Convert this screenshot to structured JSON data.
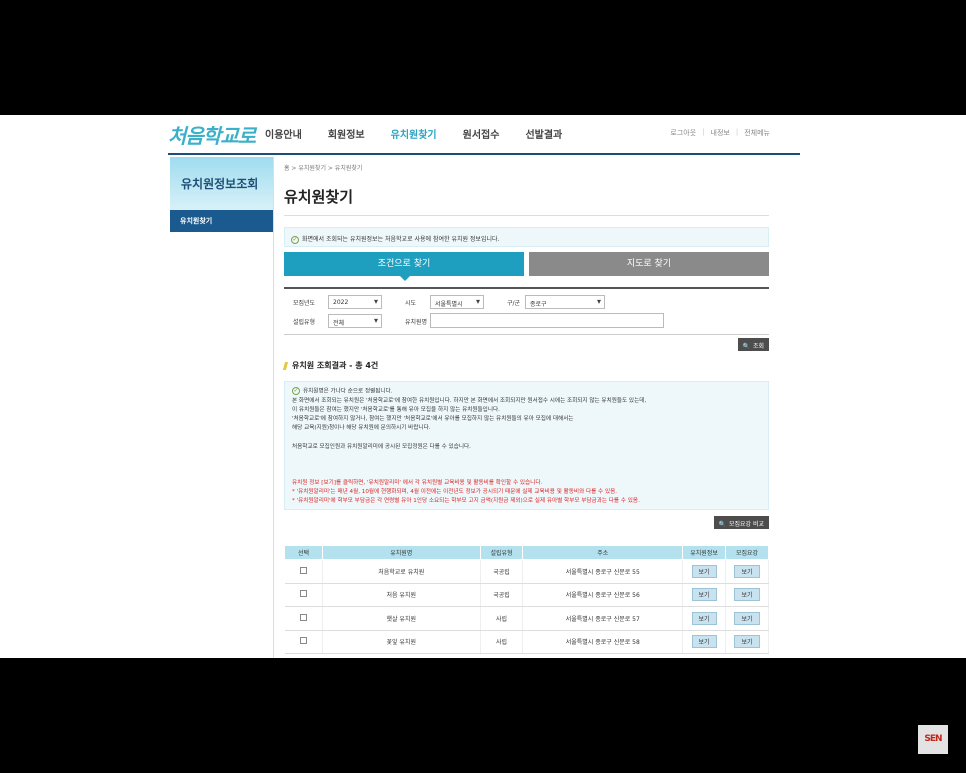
{
  "header": {
    "logo_text": "처음학교로",
    "menu": [
      "이용안내",
      "회원정보",
      "유치원찾기",
      "원서접수",
      "선발결과"
    ],
    "util": [
      "로그아웃",
      "내정보",
      "전체메뉴"
    ]
  },
  "sidebar": {
    "title": "유치원정보조회",
    "items": [
      {
        "label": "유치원찾기"
      }
    ]
  },
  "breadcrumb": "홈 > 유치원찾기 > 유치원찾기",
  "page_title": "유치원찾기",
  "notice": "화면에서 조회되는 유치원정보는 처음학교로 사용에 참여한 유치원 정보입니다.",
  "tabs": {
    "condition": "조건으로 찾기",
    "map": "지도로 찾기"
  },
  "search": {
    "year_label": "모집년도",
    "year_value": "2022",
    "sido_label": "시도",
    "sido_value": "서울특별시",
    "gu_label": "구/군",
    "gu_value": "종로구",
    "type_label": "설립유형",
    "type_value": "전체",
    "name_label": "유치원명",
    "name_value": "",
    "search_button": "조회"
  },
  "result_title": "유치원 조회결과 - 총 4건",
  "info_lines": [
    "유치원명은 가나다 순으로 정렬됩니다.",
    "본 화면에서 조회되는 유치원은 '처음학교로'에 참여한 유치원입니다. 하지만 본 화면에서 조회되지만 원서접수 시에는 조회되지 않는 유치원들도 있는데,",
    "이 유치원들은 참여는 했지만 '처음학교로'를 통해 유아 모집을 하지 않는 유치원들입니다.",
    "'처음학교로'에 참여하지 않거나, 참여는 했지만 '처음학교로'에서 유아를 모집하지 않는 유치원들의 유아 모집에 대해서는",
    "해당 교육(지원)청이나 해당 유치원에 문의하시기 바랍니다.",
    "",
    "처음학교로 모집인원과 유치원알리미에 공시된 모집정원은 다를 수 있습니다."
  ],
  "info_red_lines": [
    "유치원 정보 [보기]를 클릭하면, '유치원알리미' 에서 각 유치원별 교육비용 및 활동비를 확인할 수 있습니다.",
    "* '유치원알리미'는 매년 4월, 10월에 현행화되며, 4월 이전에는 이전년도 정보가 공시되기 때문에 실제 교육비용 및 활동비와 다를 수 있음.",
    "* '유치원알리미'에 학부모 부담금은 각 연령별 유아 1인당 소요되는 학부모 고지 금액(지원금 제외)으로 실제 유아별 학부모 부담금과는 다를 수 있음."
  ],
  "compare_button": "모집요강 비교",
  "table": {
    "headers": [
      "선택",
      "유치원명",
      "설립유형",
      "주소",
      "유치원정보",
      "모집요강"
    ],
    "rows": [
      {
        "name": "처음학교로 유치원",
        "type": "국공립",
        "address": "서울특별시 종로구 신문로 55",
        "info": "보기",
        "guide": "보기"
      },
      {
        "name": "처음 유치원",
        "type": "국공립",
        "address": "서울특별시 종로구 신문로 56",
        "info": "보기",
        "guide": "보기"
      },
      {
        "name": "햇살 유치원",
        "type": "사립",
        "address": "서울특별시 종로구 신문로 57",
        "info": "보기",
        "guide": "보기"
      },
      {
        "name": "꽃잎 유치원",
        "type": "사립",
        "address": "서울특별시 종로구 신문로 58",
        "info": "보기",
        "guide": "보기"
      }
    ]
  },
  "watermark": "SEN"
}
